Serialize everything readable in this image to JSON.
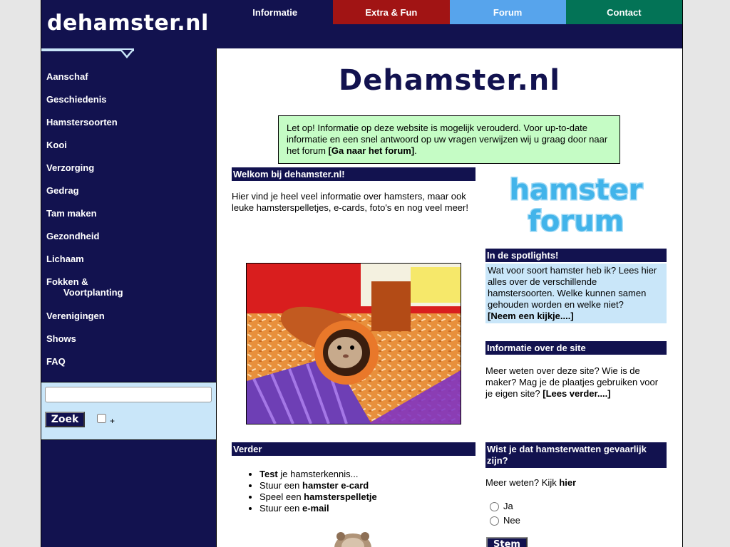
{
  "header": {
    "logo": "dehamster.nl",
    "nav": [
      {
        "label": "Informatie",
        "color": "#12124f"
      },
      {
        "label": "Extra & Fun",
        "color": "#a11414"
      },
      {
        "label": "Forum",
        "color": "#57a4ec"
      },
      {
        "label": "Contact",
        "color": "#037356"
      }
    ]
  },
  "sidebar": {
    "items": [
      {
        "label": "Aanschaf"
      },
      {
        "label": "Geschiedenis"
      },
      {
        "label": "Hamstersoorten"
      },
      {
        "label": "Kooi"
      },
      {
        "label": "Verzorging"
      },
      {
        "label": "Gedrag"
      },
      {
        "label": "Tam maken"
      },
      {
        "label": "Gezondheid"
      },
      {
        "label": "Lichaam"
      },
      {
        "label": "Fokken &",
        "sub": "Voortplanting"
      },
      {
        "label": "Verenigingen"
      },
      {
        "label": "Shows"
      },
      {
        "label": "FAQ"
      }
    ],
    "search": {
      "value": "",
      "button_label": "Zoek",
      "plus_label": "+"
    }
  },
  "main": {
    "title": "Dehamster.nl",
    "notice": {
      "text": "Let op! Informatie op deze website is mogelijk verouderd. Voor up-to-date informatie en een snel antwoord op uw vragen verwijzen wij u graag door naar het forum ",
      "link": "[Ga naar het forum]",
      "end": "."
    },
    "welcome": {
      "heading": "Welkom bij dehamster.nl!",
      "text": "Hier vind je heel veel informatie over hamsters, maar ook leuke hamsterspelletjes, e-cards, foto's en nog veel meer!"
    },
    "forum_logo": {
      "line1": "hamster",
      "line2": "forum"
    },
    "spotlight": {
      "heading": "In de spotlights!",
      "text": "Wat voor soort hamster heb ik? Lees hier alles over de verschillende hamstersoorten. Welke kunnen samen gehouden worden en welke niet?",
      "link": "[Neem een kijkje....]"
    },
    "site_info": {
      "heading": "Informatie over de site",
      "text": "Meer weten over deze site? Wie is de maker? Mag je de plaatjes gebruiken voor je eigen site? ",
      "link": "[Lees verder....]"
    },
    "verder": {
      "heading": "Verder",
      "items": [
        {
          "bold": "Test",
          "rest": " je hamsterkennis...",
          "prefix": ""
        },
        {
          "prefix": "Stuur een ",
          "bold": "hamster e-card",
          "rest": ""
        },
        {
          "prefix": "Speel een ",
          "bold": "hamsterspelletje",
          "rest": ""
        },
        {
          "prefix": "Stuur een ",
          "bold": "e-mail",
          "rest": ""
        }
      ]
    },
    "poll": {
      "heading": "Wist je dat hamsterwatten gevaarlijk zijn?",
      "text": "Meer weten? Kijk ",
      "link": "hier",
      "options": [
        "Ja",
        "Nee"
      ],
      "button_label": "Stem"
    }
  }
}
